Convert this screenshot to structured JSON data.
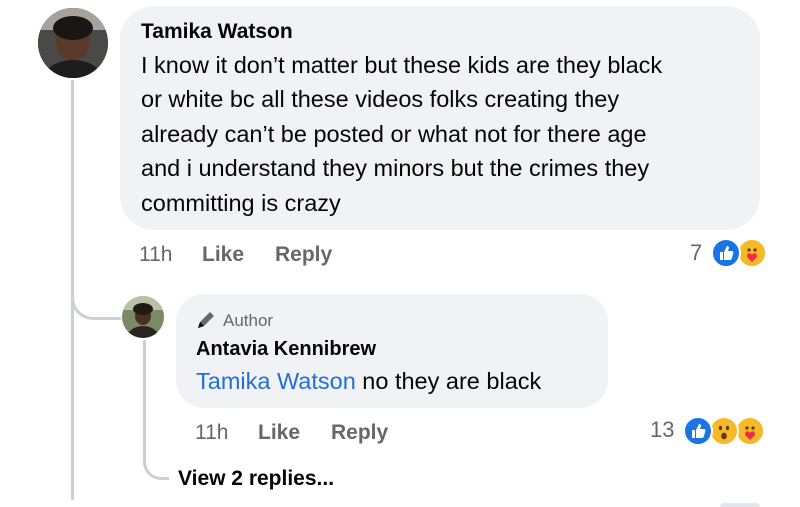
{
  "comment": {
    "author": "Tamika Watson",
    "text_lines": [
      "I know it don’t matter but these kids are they black",
      "or white bc all these videos folks creating they",
      "already can’t be posted or what not for there age",
      "and i understand they minors but the crimes they",
      "committing is crazy"
    ],
    "time": "11h",
    "like_label": "Like",
    "reply_label": "Reply",
    "reaction_count": "7",
    "reactions": [
      "like",
      "care"
    ]
  },
  "reply": {
    "badge": "Author",
    "author": "Antavia Kennibrew",
    "mention": "Tamika Watson",
    "text": " no they are black",
    "time": "11h",
    "like_label": "Like",
    "reply_label": "Reply",
    "reaction_count": "13",
    "reactions": [
      "like",
      "wow",
      "care"
    ]
  },
  "view_replies_label": "View 2 replies...",
  "colors": {
    "bubble": "#f0f2f5",
    "meta_text": "#65676b",
    "mention": "#216fdb",
    "like_blue": "#1b74e4",
    "emoji_yellow": "#f7b928"
  }
}
